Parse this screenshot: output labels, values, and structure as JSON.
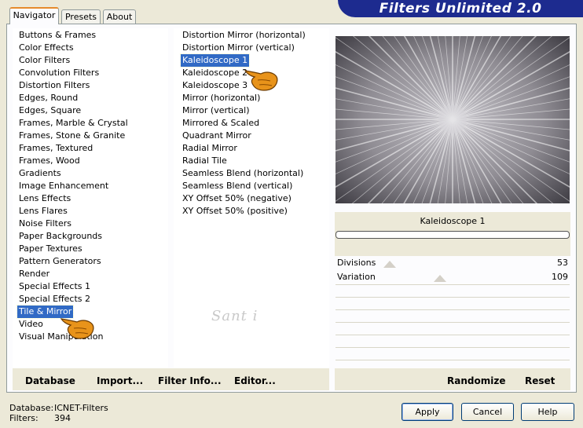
{
  "title": "Filters Unlimited 2.0",
  "tabs": [
    {
      "label": "Navigator",
      "active": true
    },
    {
      "label": "Presets",
      "active": false
    },
    {
      "label": "About",
      "active": false
    }
  ],
  "categories": [
    "Buttons & Frames",
    "Color Effects",
    "Color Filters",
    "Convolution Filters",
    "Distortion Filters",
    "Edges, Round",
    "Edges, Square",
    "Frames, Marble & Crystal",
    "Frames, Stone & Granite",
    "Frames, Textured",
    "Frames, Wood",
    "Gradients",
    "Image Enhancement",
    "Lens Effects",
    "Lens Flares",
    "Noise Filters",
    "Paper Backgrounds",
    "Paper Textures",
    "Pattern Generators",
    "Render",
    "Special Effects 1",
    "Special Effects 2",
    "Tile & Mirror",
    "Video",
    "Visual Manipulation"
  ],
  "selected_category": "Tile & Mirror",
  "filters": [
    "Distortion Mirror (horizontal)",
    "Distortion Mirror (vertical)",
    "Kaleidoscope 1",
    "Kaleidoscope 2",
    "Kaleidoscope 3",
    "Mirror (horizontal)",
    "Mirror (vertical)",
    "Mirrored & Scaled",
    "Quadrant Mirror",
    "Radial Mirror",
    "Radial Tile",
    "Seamless Blend (horizontal)",
    "Seamless Blend (vertical)",
    "XY Offset 50% (negative)",
    "XY Offset 50% (positive)"
  ],
  "selected_filter": "Kaleidoscope 1",
  "watermark": "Sant i",
  "preview_label": "Kaleidoscope 1",
  "params": [
    {
      "name": "Divisions",
      "value": "53",
      "fraction": 0.21
    },
    {
      "name": "Variation",
      "value": "109",
      "fraction": 0.43
    }
  ],
  "bottom_left": {
    "database_label": "Database",
    "import_label": "Import...",
    "filter_info_label": "Filter Info...",
    "editor_label": "Editor..."
  },
  "bottom_right": {
    "randomize_label": "Randomize",
    "reset_label": "Reset"
  },
  "status": {
    "database_key": "Database:",
    "database_value": "ICNET-Filters",
    "filters_key": "Filters:",
    "filters_value": "394"
  },
  "buttons": {
    "apply": "Apply",
    "cancel": "Cancel",
    "help": "Help"
  },
  "colors": {
    "selection": "#316ac5",
    "banner": "#1d2b8f",
    "hand": "#e8931a"
  }
}
